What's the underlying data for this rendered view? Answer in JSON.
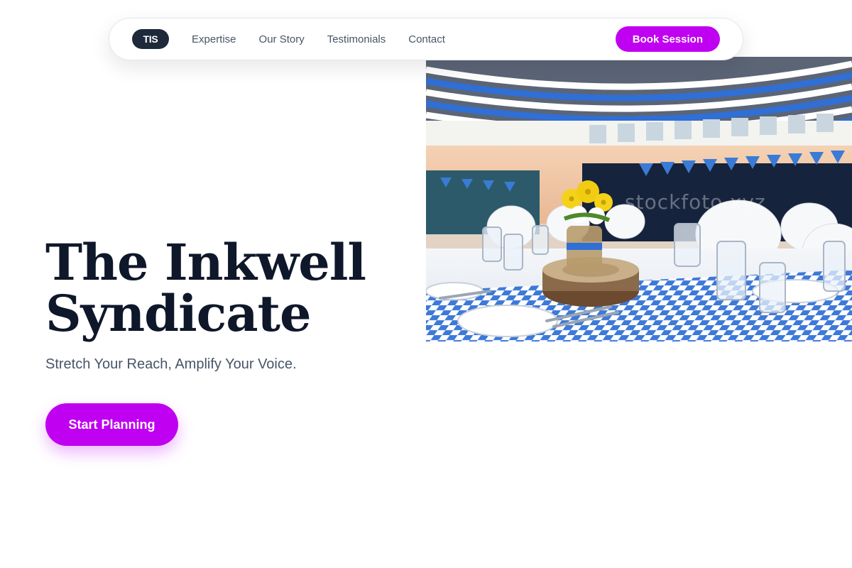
{
  "nav": {
    "logo": "TIS",
    "links": [
      "Expertise",
      "Our Story",
      "Testimonials",
      "Contact"
    ],
    "cta": "Book Session"
  },
  "hero": {
    "title_line1": "The Inkwell",
    "title_line2": "Syndicate",
    "subtitle": "Stretch Your Reach, Amplify Your Voice.",
    "cta": "Start Planning",
    "watermark": "stockfoto.xyz"
  },
  "colors": {
    "accent": "#c000f0",
    "logo_bg": "#1e293b",
    "title": "#0f172a",
    "muted": "#475569"
  },
  "image": {
    "icon": "banquet-hall-photo"
  }
}
